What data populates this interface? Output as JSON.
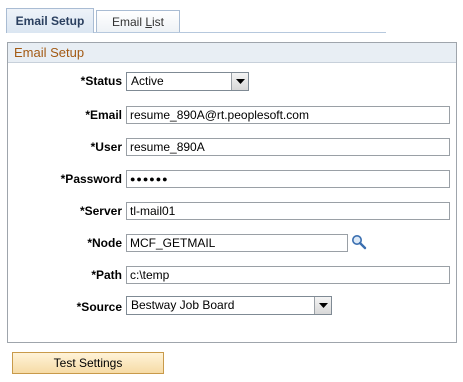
{
  "tabs": [
    {
      "label": "Email Setup",
      "active": true
    },
    {
      "label_pre": "Email ",
      "label_ul": "L",
      "label_post": "ist",
      "active": false
    }
  ],
  "group": {
    "title": "Email Setup"
  },
  "form": {
    "status": {
      "label": "*Status",
      "value": "Active"
    },
    "email": {
      "label": "*Email",
      "value": "resume_890A@rt.peoplesoft.com"
    },
    "user": {
      "label": "*User",
      "value": "resume_890A"
    },
    "password": {
      "label": "*Password",
      "value": "●●●●●●"
    },
    "server": {
      "label": "*Server",
      "value": "tl-mail01"
    },
    "node": {
      "label": "*Node",
      "value": "MCF_GETMAIL"
    },
    "path": {
      "label": "*Path",
      "value": "c:\\temp"
    },
    "source": {
      "label": "*Source",
      "value": "Bestway Job Board"
    }
  },
  "buttons": {
    "test_settings": "Test Settings"
  },
  "icons": {
    "lookup": "magnifier-icon",
    "dropdown": "chevron-down-icon"
  },
  "colors": {
    "group_title": "#a35a14",
    "button_bg": "#f6dba6",
    "tab_active_text": "#2a3f5f"
  }
}
